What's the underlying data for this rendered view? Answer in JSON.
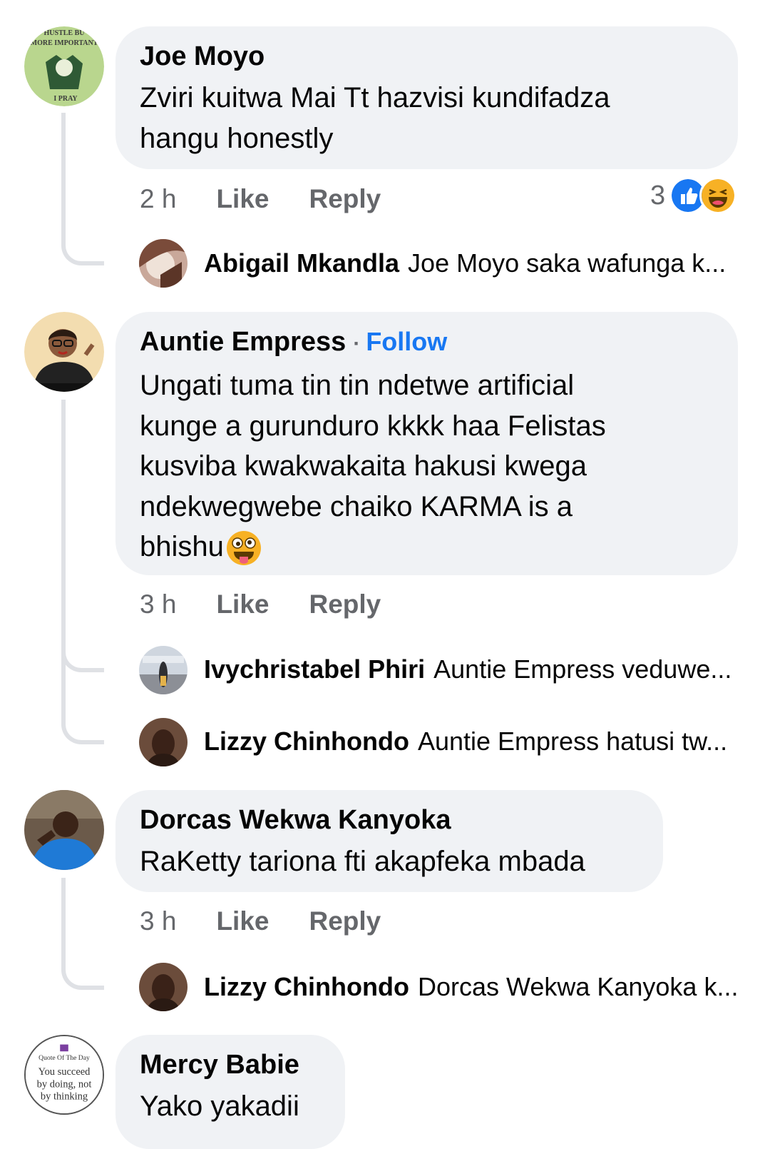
{
  "comments": [
    {
      "author": "Joe Moyo",
      "lines": [
        "Zviri kuitwa Mai Tt hazvisi kundifadza",
        "hangu honestly"
      ],
      "time": "2 h",
      "like": "Like",
      "reply": "Reply",
      "reaction_count": "3",
      "reactions": [
        "like-icon",
        "haha-icon"
      ],
      "avatar_text": {
        "top": "HUSTLE BU",
        "mid": "MORE IMPORTANT",
        "bottom": "I PRAY"
      },
      "replies": [
        {
          "name": "Abigail Mkandla",
          "text": "Joe Moyo saka wafunga k..."
        }
      ]
    },
    {
      "author": "Auntie Empress",
      "follow": "Follow",
      "lines": [
        "Ungati tuma tin tin ndetwe artificial",
        "kunge a gurunduro kkkk haa Felistas",
        "kusviba kwakwakaita hakusi kwega",
        "ndekwegwebe chaiko KARMA is a",
        "bhishu"
      ],
      "time": "3 h",
      "like": "Like",
      "reply": "Reply",
      "replies": [
        {
          "name": "Ivychristabel Phiri",
          "text": "Auntie Empress veduwe..."
        },
        {
          "name": "Lizzy Chinhondo",
          "text": "Auntie Empress  hatusi tw..."
        }
      ]
    },
    {
      "author": "Dorcas Wekwa Kanyoka",
      "lines": [
        "RaKetty tariona fti akapfeka mbada"
      ],
      "time": "3 h",
      "like": "Like",
      "reply": "Reply",
      "replies": [
        {
          "name": "Lizzy Chinhondo",
          "text": "Dorcas Wekwa Kanyoka k..."
        }
      ]
    },
    {
      "author": "Mercy Babie",
      "lines": [
        "Yako yakadii"
      ],
      "avatar_text": {
        "top": "Quote Of The Day",
        "l1": "You succeed",
        "l2": "by doing, not",
        "l3": "by thinking"
      }
    }
  ],
  "colors": {
    "link": "#1877f2",
    "bubble": "#f0f2f5",
    "meta": "#65676b",
    "thread": "#dfe1e5"
  }
}
